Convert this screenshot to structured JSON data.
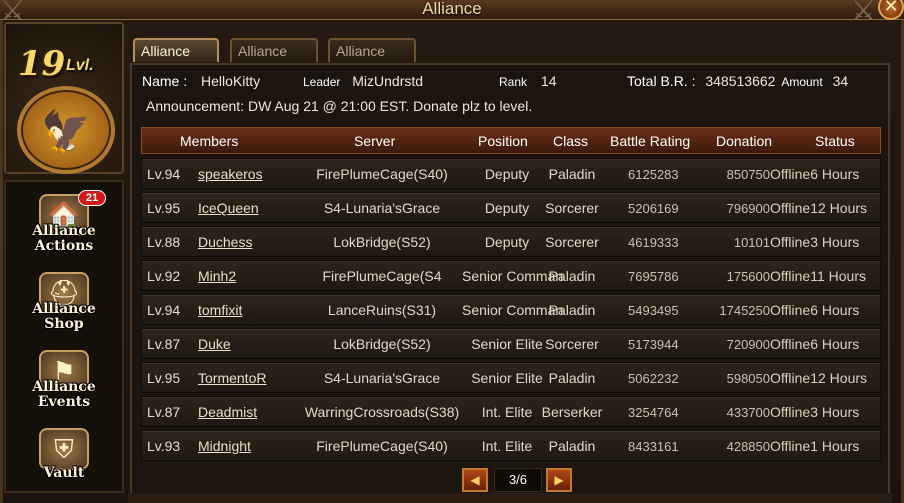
{
  "window": {
    "title": "Alliance"
  },
  "sidebar": {
    "level_number": "19",
    "level_label": "Lvl.",
    "items": [
      {
        "label_line1": "Alliance",
        "label_line2": "Actions",
        "icon": "house-chest-icon",
        "badge": "21"
      },
      {
        "label_line1": "Alliance",
        "label_line2": "Shop",
        "icon": "shop-helmet-icon",
        "badge": ""
      },
      {
        "label_line1": "Alliance",
        "label_line2": "Events",
        "icon": "events-banner-icon",
        "badge": ""
      },
      {
        "label_line1": "Vault",
        "label_line2": "",
        "icon": "vault-icon",
        "badge": ""
      }
    ]
  },
  "tabs": [
    {
      "label": "Alliance Info",
      "active": true
    },
    {
      "label": "Alliance Log",
      "active": false
    },
    {
      "label": "Alliance List",
      "active": false
    }
  ],
  "info": {
    "name_label": "Name :",
    "name_value": "HelloKitty",
    "leader_label": "Leader",
    "leader_value": "MizUndrstd",
    "rank_label": "Rank",
    "rank_value": "14",
    "total_br_label": "Total B.R. :",
    "total_br_value": "348513662",
    "amount_label": "Amount",
    "amount_value": "34",
    "announcement": "Announcement: DW Aug 21 @ 21:00 EST. Donate plz to level."
  },
  "table": {
    "headers": [
      "Members",
      "Server",
      "Position",
      "Class",
      "Battle Rating",
      "Donation",
      "Status"
    ],
    "rows": [
      {
        "level": "Lv.94",
        "name": "speakeros",
        "server": "FirePlumeCage(S40)",
        "position": "Deputy",
        "class": "Paladin",
        "battle_rating": "6125283",
        "donation": "850750",
        "status": "Offline6 Hours"
      },
      {
        "level": "Lv.95",
        "name": "IceQueen",
        "server": "S4-Lunaria'sGrace",
        "position": "Deputy",
        "class": "Sorcerer",
        "battle_rating": "5206169",
        "donation": "796900",
        "status": "Offline12 Hours"
      },
      {
        "level": "Lv.88",
        "name": "Duchess",
        "server": "LokBridge(S52)",
        "position": "Deputy",
        "class": "Sorcerer",
        "battle_rating": "4619333",
        "donation": "10101",
        "status": "Offline3 Hours"
      },
      {
        "level": "Lv.92",
        "name": "Minh2",
        "server": "FirePlumeCage(S4",
        "position": "Senior Comman",
        "class": "Paladin",
        "battle_rating": "7695786",
        "donation": "175600",
        "status": "Offline11 Hours"
      },
      {
        "level": "Lv.94",
        "name": "tomfixit",
        "server": "LanceRuins(S31)",
        "position": "Senior Comman",
        "class": "Paladin",
        "battle_rating": "5493495",
        "donation": "1745250",
        "status": "Offline6 Hours"
      },
      {
        "level": "Lv.87",
        "name": "Duke",
        "server": "LokBridge(S52)",
        "position": "Senior Elite",
        "class": "Sorcerer",
        "battle_rating": "5173944",
        "donation": "720900",
        "status": "Offline6 Hours"
      },
      {
        "level": "Lv.95",
        "name": "TormentoR",
        "server": "S4-Lunaria'sGrace",
        "position": "Senior Elite",
        "class": "Paladin",
        "battle_rating": "5062232",
        "donation": "598050",
        "status": "Offline12 Hours"
      },
      {
        "level": "Lv.87",
        "name": "Deadmist",
        "server": "WarringCrossroads(S38)",
        "position": "Int. Elite",
        "class": "Berserker",
        "battle_rating": "3254764",
        "donation": "433700",
        "status": "Offline3 Hours"
      },
      {
        "level": "Lv.93",
        "name": "Midnight",
        "server": "FirePlumeCage(S40)",
        "position": "Int. Elite",
        "class": "Paladin",
        "battle_rating": "8433161",
        "donation": "428850",
        "status": "Offline1 Hours"
      }
    ]
  },
  "pager": {
    "text": "3/6",
    "prev_icon": "arrow-left-icon",
    "next_icon": "arrow-right-icon"
  },
  "colors": {
    "header_bar": "#6a2f16",
    "gold_text": "#f7d86a",
    "badge_red": "#d01818"
  }
}
